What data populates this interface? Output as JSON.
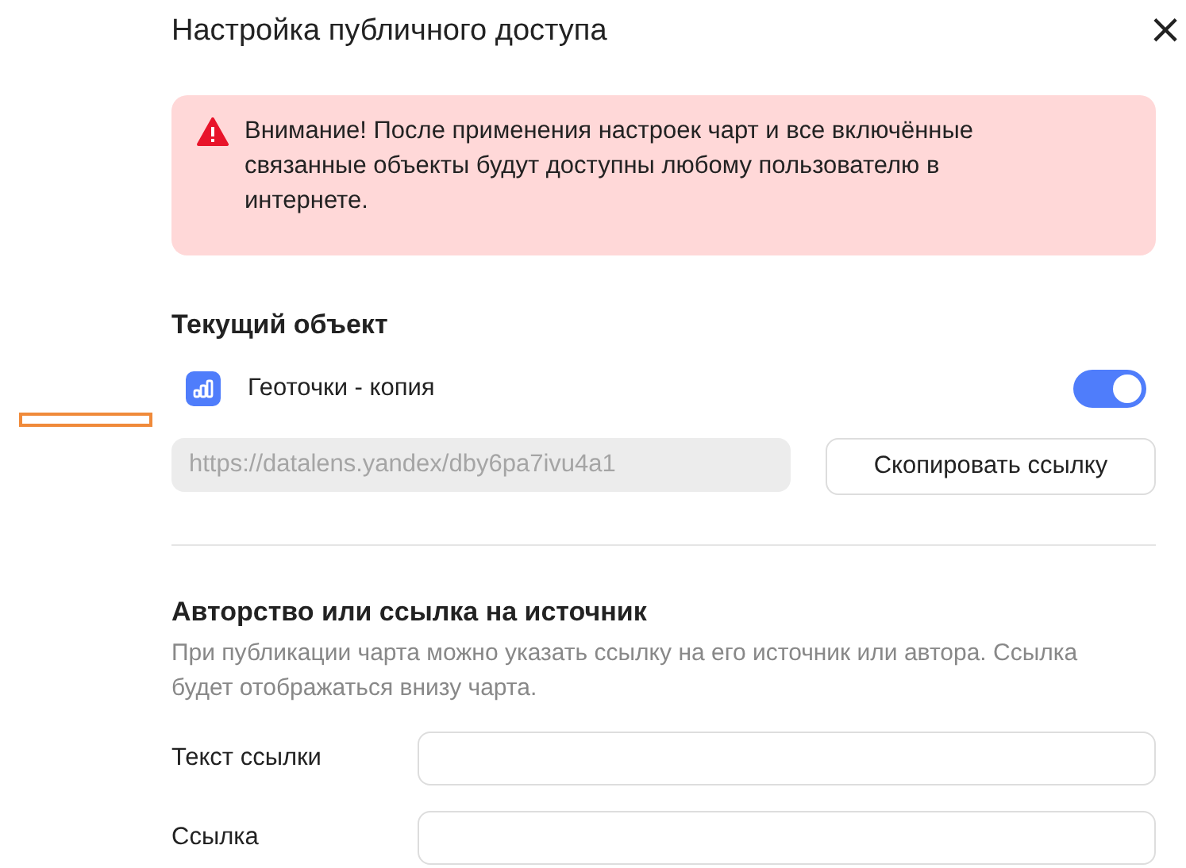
{
  "dialog": {
    "title": "Настройка публичного доступа",
    "close": "×"
  },
  "alert": {
    "text": "Внимание! После применения настроек чарт и все включённые связанные объекты будут доступны любому пользователю в интернете."
  },
  "current_object": {
    "heading": "Текущий объект",
    "name": "Геоточки - копия",
    "on": true,
    "url": "https://datalens.yandex/dby6pa7ivu4a1",
    "copy_button": "Скопировать ссылку"
  },
  "attribution": {
    "heading": "Авторство или ссылка на источник",
    "description": "При публикации чарта можно указать ссылку на его источник или автора. Ссылка будет отображаться внизу чарта.",
    "fields": [
      {
        "label": "Текст ссылки"
      },
      {
        "label": "Ссылка"
      }
    ]
  }
}
